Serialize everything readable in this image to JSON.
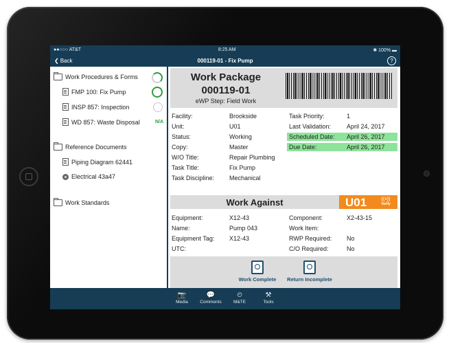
{
  "status_bar": {
    "carrier": "●●○○○ AT&T",
    "wifi_icon": "wifi-icon",
    "time": "8:25 AM",
    "battery": "100%"
  },
  "nav": {
    "back_label": "Back",
    "title": "000119-01 - Fix Pump",
    "help": "?"
  },
  "sidebar": {
    "sections": [
      {
        "label": "Work Procedures & Forms"
      },
      {
        "label": "Reference Documents"
      },
      {
        "label": "Work Standards"
      }
    ],
    "procedures": [
      {
        "label": "FMP 100: Fix Pump",
        "status": "complete"
      },
      {
        "label": "INSP 857: Inspection",
        "status": "pending"
      },
      {
        "label": "WD 857: Waste Disposal",
        "status": "N/A"
      }
    ],
    "references": [
      {
        "label": "Piping Diagram 62441"
      },
      {
        "label": "Electrical 43a47"
      }
    ]
  },
  "work_package": {
    "title": "Work Package",
    "number": "000119-01",
    "step": "eWP Step: Field Work"
  },
  "details_left": [
    {
      "label": "Facility:",
      "value": "Brookside"
    },
    {
      "label": "Unit:",
      "value": "U01"
    },
    {
      "label": "Status:",
      "value": "Working"
    },
    {
      "label": "Copy:",
      "value": "Master"
    },
    {
      "label": "W/O Title:",
      "value": "Repair Plumbing"
    },
    {
      "label": "Task Title:",
      "value": "Fix Pump"
    },
    {
      "label": "Task Discipline:",
      "value": "Mechanical"
    }
  ],
  "details_right": [
    {
      "label": "Task Priority:",
      "value": "1"
    },
    {
      "label": "Last Validation:",
      "value": "April 24, 2017"
    },
    {
      "label": "Scheduled Date:",
      "value": "April 26, 2017"
    },
    {
      "label": "Due Date:",
      "value": "April 26, 2017"
    }
  ],
  "highlight_color": "#8ee39a",
  "work_against": {
    "title": "Work Against",
    "unit": "U01",
    "verify_label": "Verify",
    "unit_color": "#f28a1e"
  },
  "equip_left": [
    {
      "label": "Equipment:",
      "value": "X12-43"
    },
    {
      "label": "Name:",
      "value": "Pump 043"
    },
    {
      "label": "Equipment Tag:",
      "value": "X12-43"
    },
    {
      "label": "UTC:",
      "value": ""
    }
  ],
  "equip_right": [
    {
      "label": "Component:",
      "value": "X2-43-15"
    },
    {
      "label": "Work Item:",
      "value": ""
    },
    {
      "label": "RWP Required:",
      "value": "No"
    },
    {
      "label": "C/O Required:",
      "value": "No"
    }
  ],
  "actions": [
    {
      "label": "Work Complete"
    },
    {
      "label": "Return Incomplete"
    }
  ],
  "tabs": [
    {
      "label": "Media",
      "icon": "📷"
    },
    {
      "label": "Comments",
      "icon": "💬"
    },
    {
      "label": "M&TE",
      "icon": "⏲"
    },
    {
      "label": "Tools",
      "icon": "⚒"
    }
  ]
}
